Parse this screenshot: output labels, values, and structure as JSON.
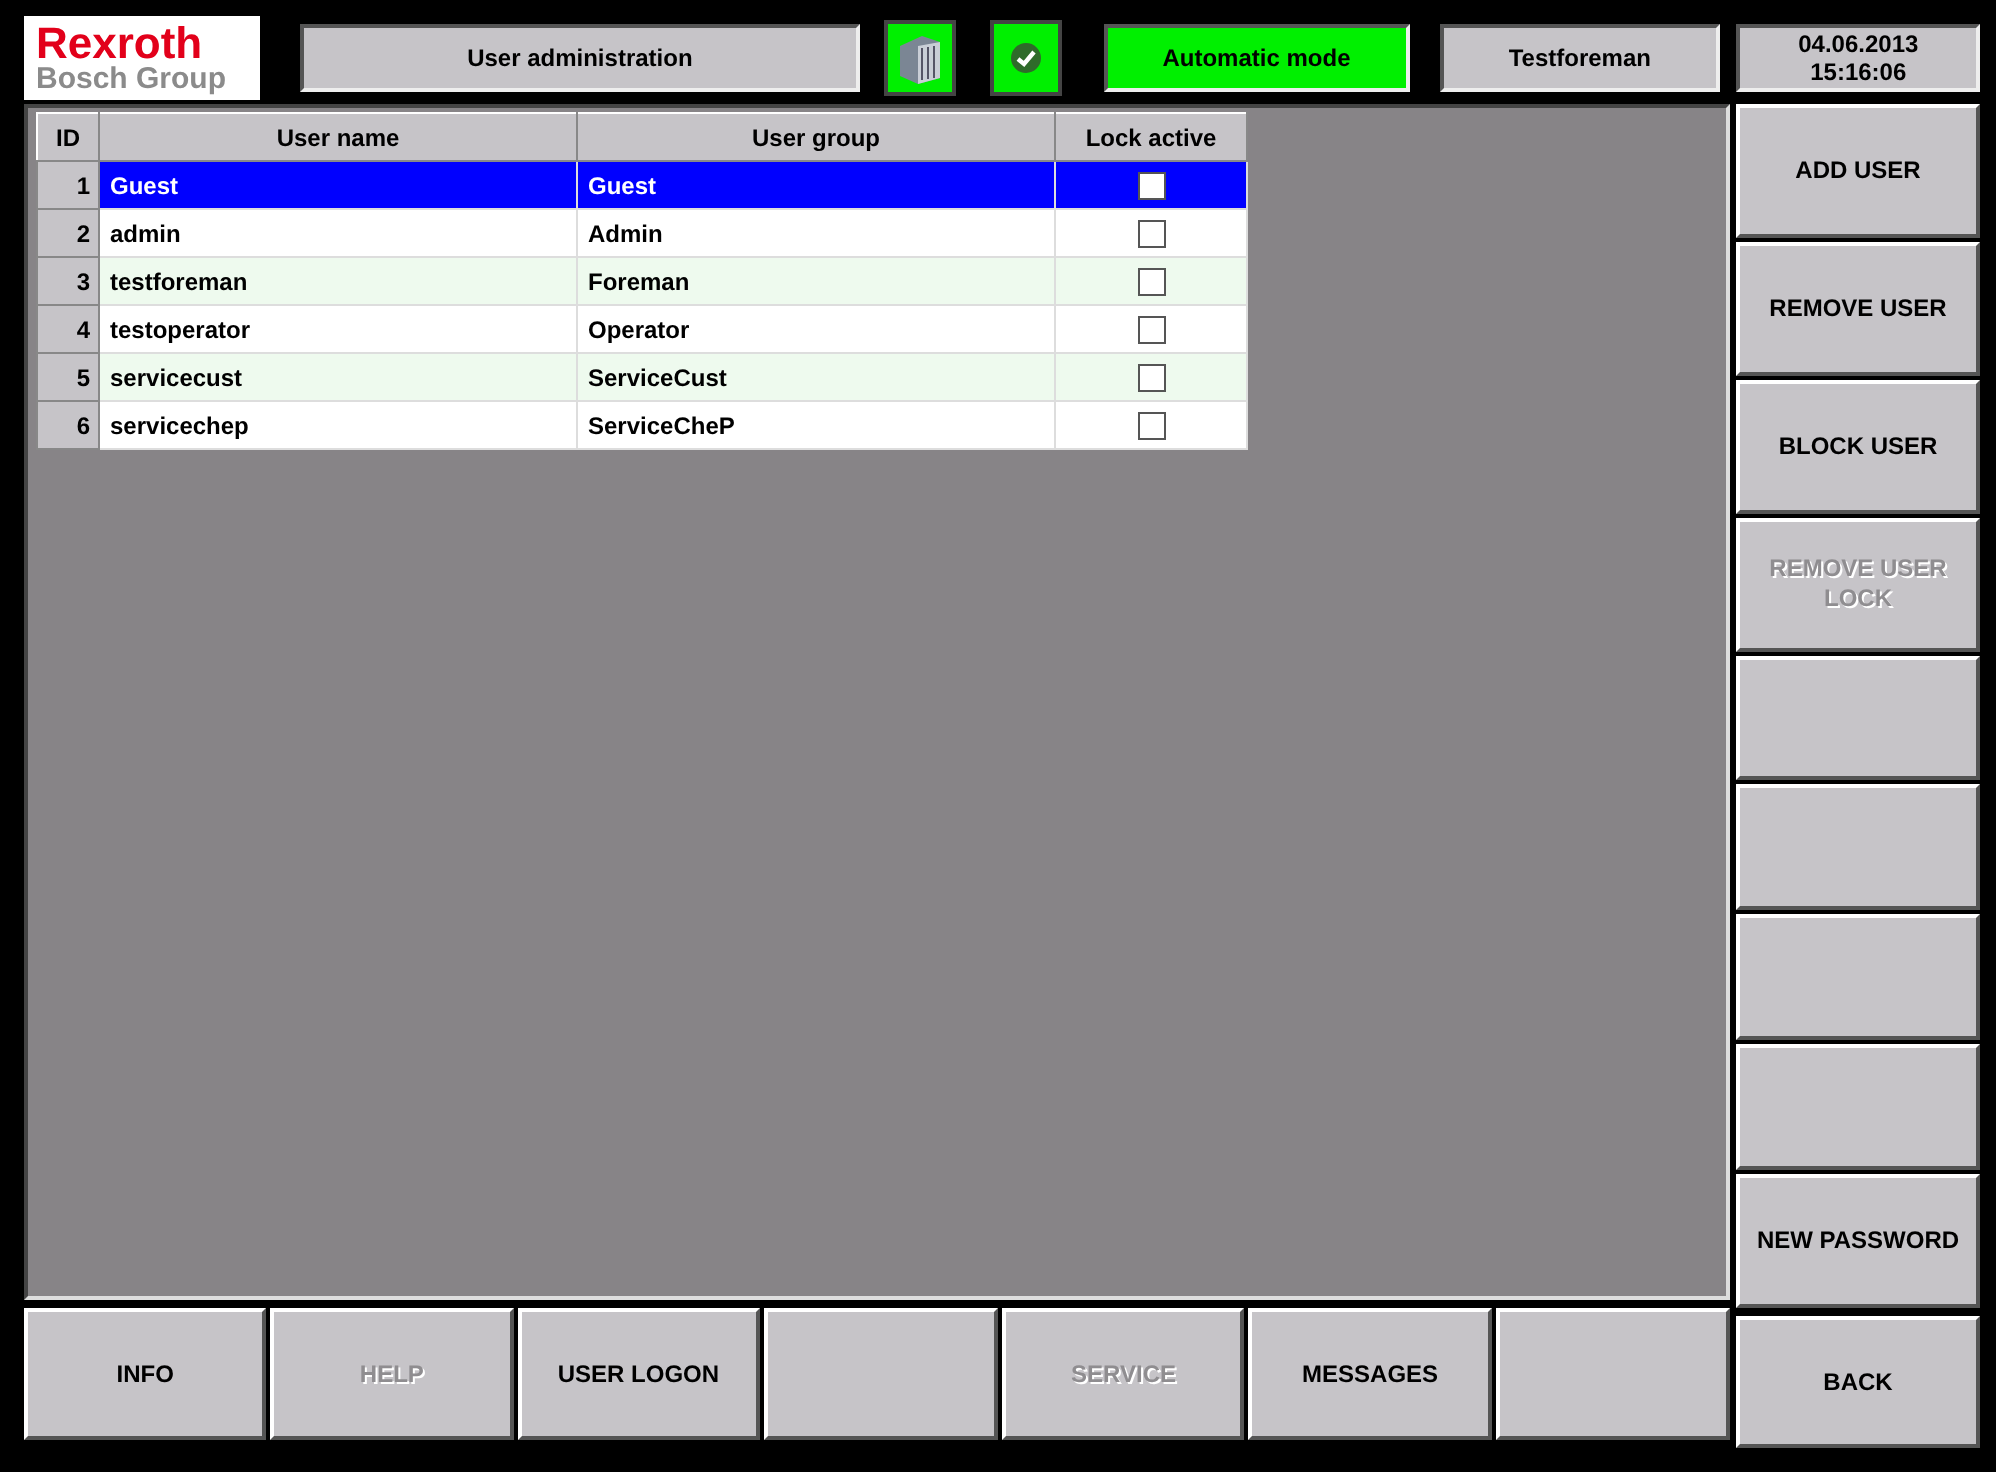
{
  "header": {
    "logo": {
      "brand": "Rexroth",
      "group": "Bosch Group"
    },
    "title": "User administration",
    "plc_ok": true,
    "status_ok": true,
    "mode": "Automatic mode",
    "user": "Testforeman",
    "date": "04.06.2013",
    "time": "15:16:06"
  },
  "table": {
    "columns": [
      "ID",
      "User name",
      "User group",
      "Lock active"
    ],
    "rows": [
      {
        "id": "1",
        "name": "Guest",
        "group": "Guest",
        "locked": false,
        "selected": true
      },
      {
        "id": "2",
        "name": "admin",
        "group": "Admin",
        "locked": false,
        "selected": false
      },
      {
        "id": "3",
        "name": "testforeman",
        "group": "Foreman",
        "locked": false,
        "selected": false
      },
      {
        "id": "4",
        "name": "testoperator",
        "group": "Operator",
        "locked": false,
        "selected": false
      },
      {
        "id": "5",
        "name": "servicecust",
        "group": "ServiceCust",
        "locked": false,
        "selected": false
      },
      {
        "id": "6",
        "name": "servicechep",
        "group": "ServiceCheP",
        "locked": false,
        "selected": false
      }
    ]
  },
  "side_buttons": [
    {
      "kind": "button",
      "label": "ADD USER",
      "disabled": false
    },
    {
      "kind": "button",
      "label": "REMOVE USER",
      "disabled": false
    },
    {
      "kind": "button",
      "label": "BLOCK USER",
      "disabled": false
    },
    {
      "kind": "button",
      "label": "REMOVE USER LOCK",
      "disabled": true
    },
    {
      "kind": "blank"
    },
    {
      "kind": "blank"
    },
    {
      "kind": "blank"
    },
    {
      "kind": "blank"
    },
    {
      "kind": "button",
      "label": "NEW PASSWORD",
      "disabled": false
    }
  ],
  "bottom_buttons": [
    {
      "kind": "button",
      "label": "INFO",
      "disabled": false
    },
    {
      "kind": "button",
      "label": "HELP",
      "disabled": true
    },
    {
      "kind": "button",
      "label": "USER LOGON",
      "disabled": false
    },
    {
      "kind": "blank"
    },
    {
      "kind": "button",
      "label": "SERVICE",
      "disabled": true
    },
    {
      "kind": "button",
      "label": "MESSAGES",
      "disabled": false
    },
    {
      "kind": "blank"
    },
    {
      "kind": "button",
      "label": "BACK",
      "disabled": false
    }
  ]
}
